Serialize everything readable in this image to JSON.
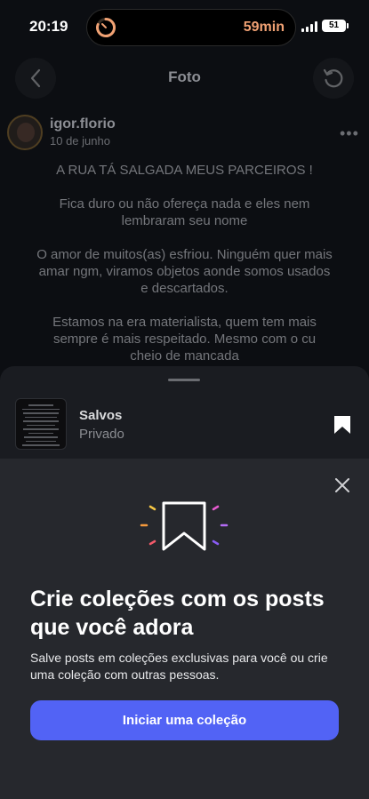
{
  "status_bar": {
    "time": "20:19",
    "timer": "59min",
    "battery": "51",
    "accent_color": "#f1a274"
  },
  "header": {
    "title": "Foto",
    "back_icon": "chevron-left-icon",
    "refresh_icon": "refresh-icon"
  },
  "post": {
    "username": "igor.florio",
    "date": "10 de junho",
    "more_icon": "more-dots-icon",
    "paragraphs": [
      "A RUA TÁ SALGADA MEUS PARCEIROS !",
      "Fica duro ou não ofereça nada e eles nem lembraram seu nome",
      "O amor de muitos(as) esfriou. Ninguém quer mais amar ngm, viramos objetos aonde somos usados e descartados.",
      "Estamos na era materialista, quem tem mais sempre é mais respeitado. Mesmo com o cu cheio de mancada"
    ]
  },
  "saved_sheet": {
    "collection_name": "Salvos",
    "privacy": "Privado",
    "bookmark_icon": "bookmark-filled-icon"
  },
  "collections_modal": {
    "close_icon": "close-icon",
    "hero_icon": "bookmark-outline-icon",
    "headline": "Crie coleções com os posts que você adora",
    "description": "Salve posts em coleções exclusivas para você ou crie uma coleção com outras pessoas.",
    "cta_label": "Iniciar uma coleção",
    "cta_color": "#5263f5"
  }
}
